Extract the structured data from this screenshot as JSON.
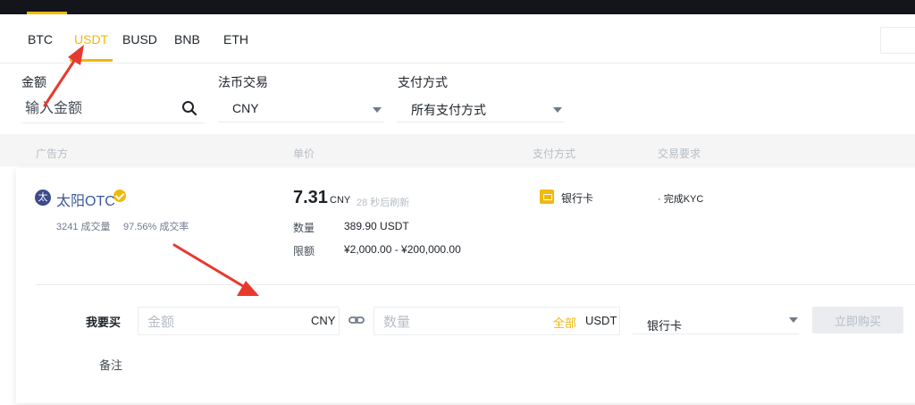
{
  "tabs": [
    {
      "label": "BTC",
      "active": false
    },
    {
      "label": "USDT",
      "active": true
    },
    {
      "label": "BUSD",
      "active": false
    },
    {
      "label": "BNB",
      "active": false
    },
    {
      "label": "ETH",
      "active": false
    }
  ],
  "filters": {
    "amount_label": "金额",
    "amount_placeholder": "输入金额",
    "fiat_label": "法币交易",
    "fiat_value": "CNY",
    "payment_label": "支付方式",
    "payment_value": "所有支付方式"
  },
  "table_headers": {
    "advertiser": "广告方",
    "price": "单价",
    "payment": "支付方式",
    "requirement": "交易要求"
  },
  "advert": {
    "avatar_char": "太",
    "name": "太阳OTC",
    "orders": "3241 成交量",
    "completion": "97.56% 成交率",
    "price": "7.31",
    "price_currency": "CNY",
    "refresh_text": "28 秒后刷新",
    "qty_label": "数量",
    "qty_value": "389.90 USDT",
    "limit_label": "限额",
    "limit_value": "¥2,000.00 - ¥200,000.00",
    "payment_method": "银行卡",
    "requirement": "· 完成KYC"
  },
  "buy_form": {
    "label": "我要买",
    "amount_placeholder": "金额",
    "amount_suffix": "CNY",
    "qty_placeholder": "数量",
    "all_label": "全部",
    "qty_suffix": "USDT",
    "payment_value": "银行卡",
    "buy_button": "立即购买",
    "remark_label": "备注"
  },
  "colors": {
    "accent": "#f0b90b",
    "dark": "#14151a",
    "annotation_arrow": "#e8392e",
    "advertiser_name": "#3b5998"
  }
}
